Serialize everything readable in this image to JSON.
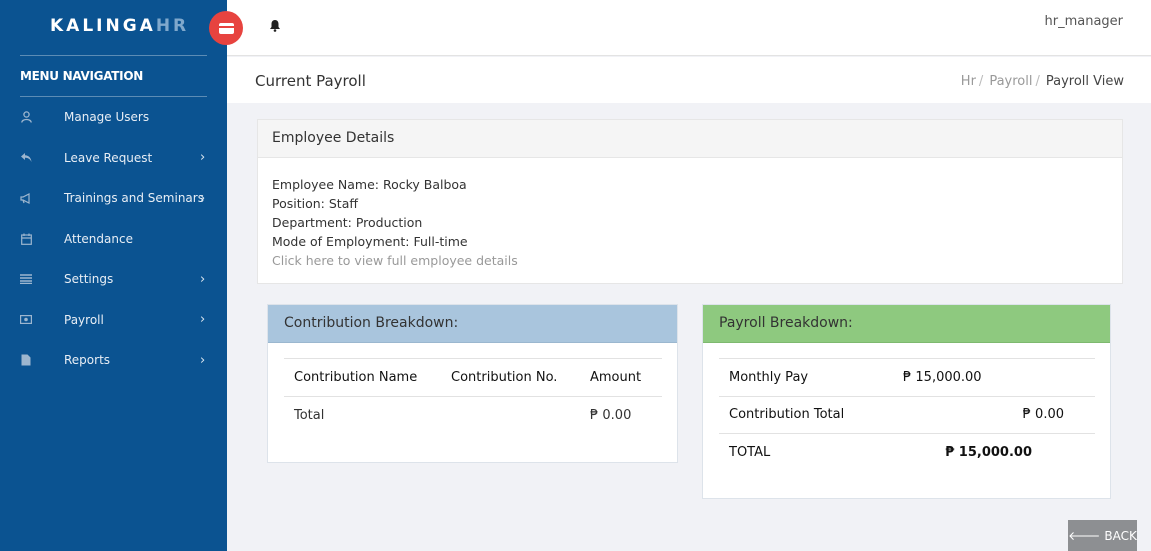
{
  "app": {
    "logo_main": "KALINGA",
    "logo_accent": "HR"
  },
  "sidebar": {
    "title": "MENU NAVIGATION",
    "items": [
      {
        "label": "Manage Users",
        "icon": "user-icon",
        "has_submenu": false
      },
      {
        "label": "Leave Request",
        "icon": "reply-icon",
        "has_submenu": true
      },
      {
        "label": "Trainings and Seminars",
        "icon": "bullhorn-icon",
        "has_submenu": true
      },
      {
        "label": "Attendance",
        "icon": "calendar-icon",
        "has_submenu": false
      },
      {
        "label": "Settings",
        "icon": "list-icon",
        "has_submenu": true
      },
      {
        "label": "Payroll",
        "icon": "money-icon",
        "has_submenu": true
      },
      {
        "label": "Reports",
        "icon": "file-icon",
        "has_submenu": true
      }
    ]
  },
  "header": {
    "user": "hr_manager"
  },
  "subheader": {
    "title": "Current Payroll",
    "breadcrumb": [
      "Hr",
      "Payroll",
      "Payroll View"
    ]
  },
  "employee": {
    "heading": "Employee Details",
    "name": "Employee Name: Rocky Balboa",
    "position": "Position: Staff",
    "department": "Department: Production",
    "mode": "Mode of Employment: Full-time",
    "link": "Click here to view full employee details"
  },
  "contribution": {
    "heading": "Contribution Breakdown:",
    "columns": [
      "Contribution Name",
      "Contribution No.",
      "Amount"
    ],
    "total_label": "Total",
    "total_amount": "₱ 0.00"
  },
  "payroll": {
    "heading": "Payroll Breakdown:",
    "monthly_label": "Monthly Pay",
    "monthly_value": "₱ 15,000.00",
    "contrib_label": "Contribution Total",
    "contrib_value": "₱ 0.00",
    "total_label": "TOTAL",
    "total_value": "₱ 15,000.00"
  },
  "back_button": "BACK",
  "colors": {
    "sidebar": "#0b5391",
    "toggle": "#e7433f",
    "contribution_header": "#a9c5dd",
    "payroll_header": "#8ec97f",
    "back_button": "#8d8f92"
  }
}
